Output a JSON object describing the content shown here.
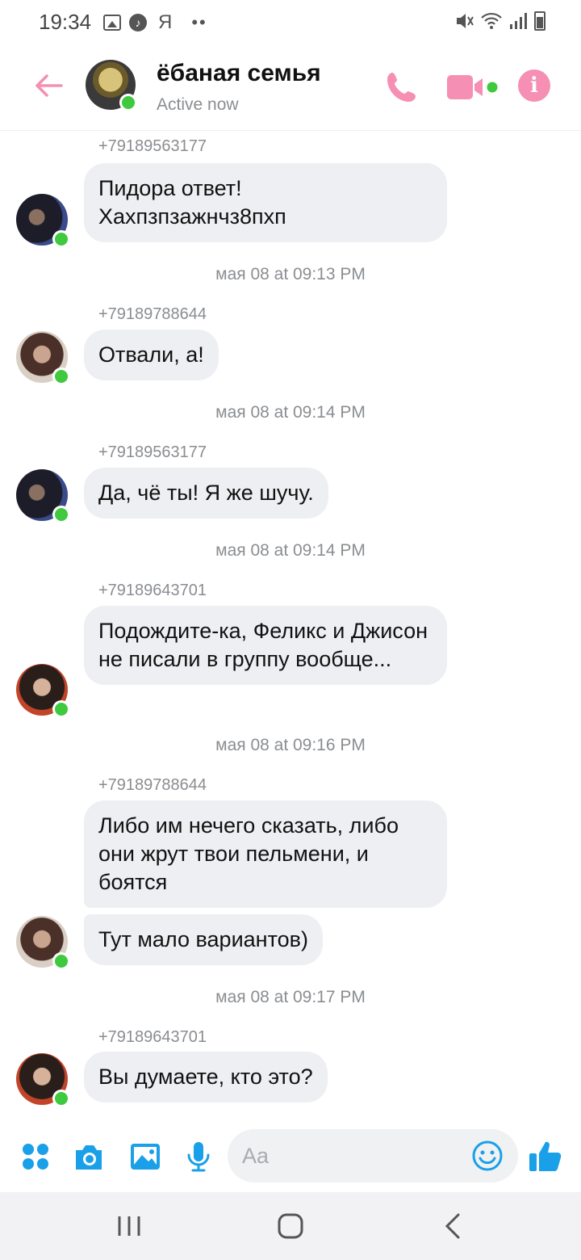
{
  "status_bar": {
    "time": "19:34",
    "extra_glyph": "Я",
    "dots": "••"
  },
  "header": {
    "title": "ёбаная семья",
    "status": "Active now",
    "accent_color": "#f58fb3",
    "online_color": "#3ec93e"
  },
  "messages": [
    {
      "sender": "+79189563177",
      "bubbles": [
        "Пидора ответ! Хахпзпзажнчз8пхп"
      ],
      "timestamp": "мая 08 at 09:13 PM"
    },
    {
      "sender": "+79189788644",
      "bubbles": [
        "Отвали, а!"
      ],
      "timestamp": "мая 08 at 09:14 PM"
    },
    {
      "sender": "+79189563177",
      "bubbles": [
        "Да, чё ты! Я же шучу."
      ],
      "timestamp": "мая 08 at 09:14 PM"
    },
    {
      "sender": "+79189643701",
      "bubbles": [
        "Подождите-ка, Феликс и Джисон не писали в группу вообще..."
      ],
      "timestamp": "мая 08 at 09:16 PM"
    },
    {
      "sender": "+79189788644",
      "bubbles": [
        "Либо им нечего сказать, либо они жрут твои пельмени, и боятся",
        "Тут мало вариантов)"
      ],
      "timestamp": "мая 08 at 09:17 PM"
    },
    {
      "sender": "+79189643701",
      "bubbles": [
        "Вы думаете, кто это?"
      ]
    }
  ],
  "composer": {
    "placeholder": "Aa",
    "icon_color": "#1aa0e8"
  }
}
